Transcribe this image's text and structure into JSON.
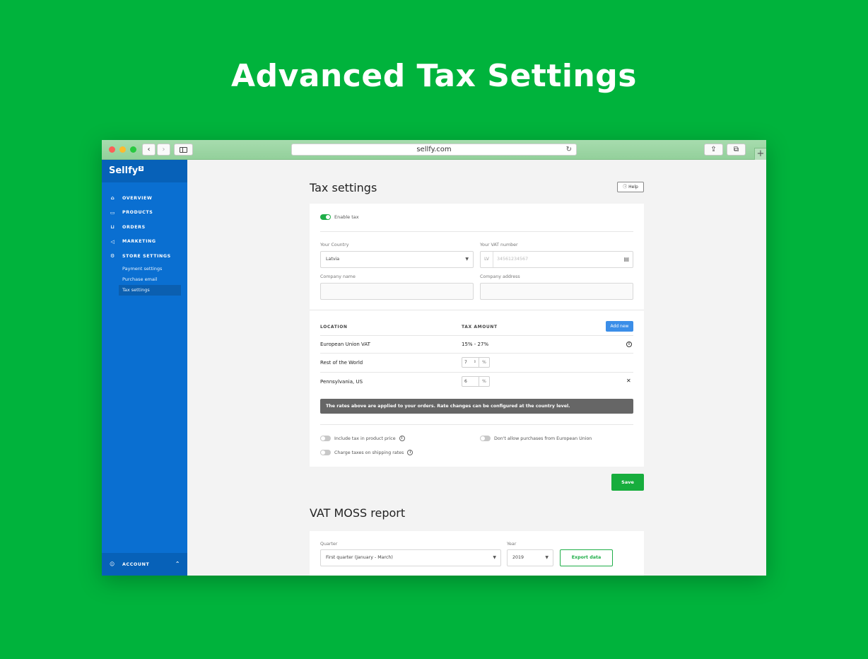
{
  "hero": {
    "title": "Advanced Tax Settings"
  },
  "browser": {
    "url": "sellfy.com",
    "reload_icon": "reload-icon"
  },
  "sidebar": {
    "logo": "Sellfy",
    "logo_badge": "S",
    "items": [
      {
        "label": "OVERVIEW",
        "icon": "home-icon"
      },
      {
        "label": "PRODUCTS",
        "icon": "folder-icon"
      },
      {
        "label": "ORDERS",
        "icon": "basket-icon"
      },
      {
        "label": "MARKETING",
        "icon": "megaphone-icon"
      },
      {
        "label": "STORE SETTINGS",
        "icon": "gear-icon"
      }
    ],
    "sub_items": [
      {
        "label": "Payment settings"
      },
      {
        "label": "Purchase email"
      },
      {
        "label": "Tax settings",
        "active": true
      }
    ],
    "account": "ACCOUNT"
  },
  "tax": {
    "title": "Tax settings",
    "help": "Help",
    "enable_label": "Enable tax",
    "enable_on": true,
    "country_label": "Your Country",
    "country_value": "Latvia",
    "vat_label": "Your VAT number",
    "vat_prefix": "LV",
    "vat_placeholder": "34561234567",
    "company_name_label": "Company name",
    "company_address_label": "Company address",
    "table": {
      "col_location": "LOCATION",
      "col_tax": "TAX AMOUNT",
      "add_new": "Add new",
      "rows": [
        {
          "location": "European Union VAT",
          "tax": "15% - 27%"
        },
        {
          "location": "Rest of the World",
          "value": "7",
          "unit": "%"
        },
        {
          "location": "Pennsylvania, US",
          "value": "6",
          "unit": "%"
        }
      ]
    },
    "notice": "The rates above are applied to your orders. Rate changes can be configured at the country level.",
    "options": {
      "include_tax": "Include tax in product price",
      "charge_shipping": "Charge taxes on shipping rates",
      "no_eu": "Don't allow purchases from European Union"
    },
    "save": "Save"
  },
  "vat_moss": {
    "title": "VAT MOSS report",
    "quarter_label": "Quarter",
    "quarter_value": "First quarter (January - March)",
    "year_label": "Year",
    "year_value": "2019",
    "export": "Export data"
  },
  "colors": {
    "background": "#00b33c",
    "sidebar": "#0a6fd1",
    "accent_green": "#17ad3d",
    "accent_blue": "#3b8ee8"
  }
}
